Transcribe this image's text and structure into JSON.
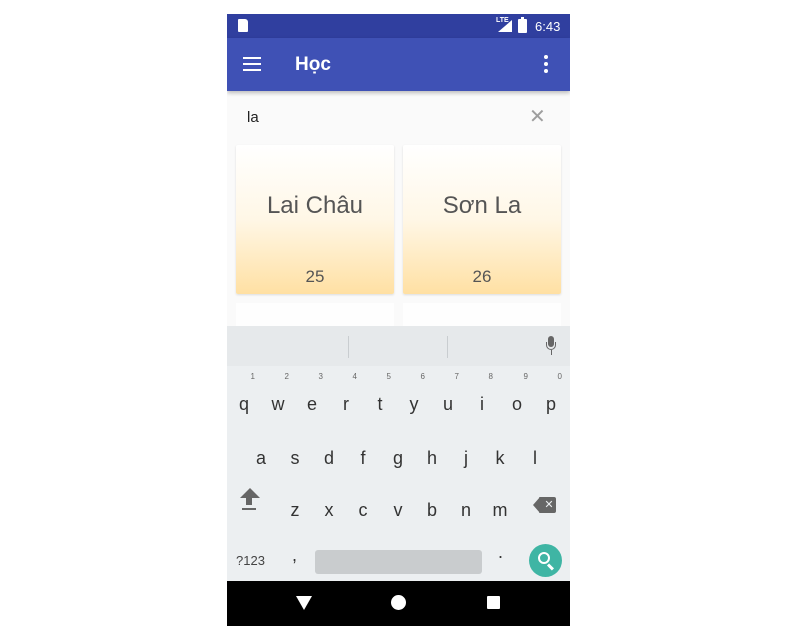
{
  "status_bar": {
    "network_label": "LTE",
    "time": "6:43",
    "icons": [
      "sd-card-icon",
      "signal-icon",
      "battery-icon"
    ]
  },
  "app_bar": {
    "title": "Học",
    "icons": [
      "menu-icon",
      "more-vert-icon"
    ],
    "color": "#3f51b5"
  },
  "search": {
    "value": "la",
    "clear_icon": "close-icon"
  },
  "cards": [
    {
      "name": "Lai Châu",
      "number": "25"
    },
    {
      "name": "Sơn La",
      "number": "26"
    }
  ],
  "keyboard": {
    "row1": [
      {
        "key": "q",
        "hint": "1"
      },
      {
        "key": "w",
        "hint": "2"
      },
      {
        "key": "e",
        "hint": "3"
      },
      {
        "key": "r",
        "hint": "4"
      },
      {
        "key": "t",
        "hint": "5"
      },
      {
        "key": "y",
        "hint": "6"
      },
      {
        "key": "u",
        "hint": "7"
      },
      {
        "key": "i",
        "hint": "8"
      },
      {
        "key": "o",
        "hint": "9"
      },
      {
        "key": "p",
        "hint": "0"
      }
    ],
    "row2": [
      "a",
      "s",
      "d",
      "f",
      "g",
      "h",
      "j",
      "k",
      "l"
    ],
    "row3": [
      "z",
      "x",
      "c",
      "v",
      "b",
      "n",
      "m"
    ],
    "symbols_label": "?123",
    "comma_label": ",",
    "period_label": ".",
    "accent_color": "#3fb5a4",
    "icons": [
      "mic-icon",
      "shift-icon",
      "backspace-icon",
      "search-icon"
    ]
  },
  "nav_bar": {
    "icons": [
      "back-icon",
      "home-icon",
      "recents-icon"
    ]
  }
}
